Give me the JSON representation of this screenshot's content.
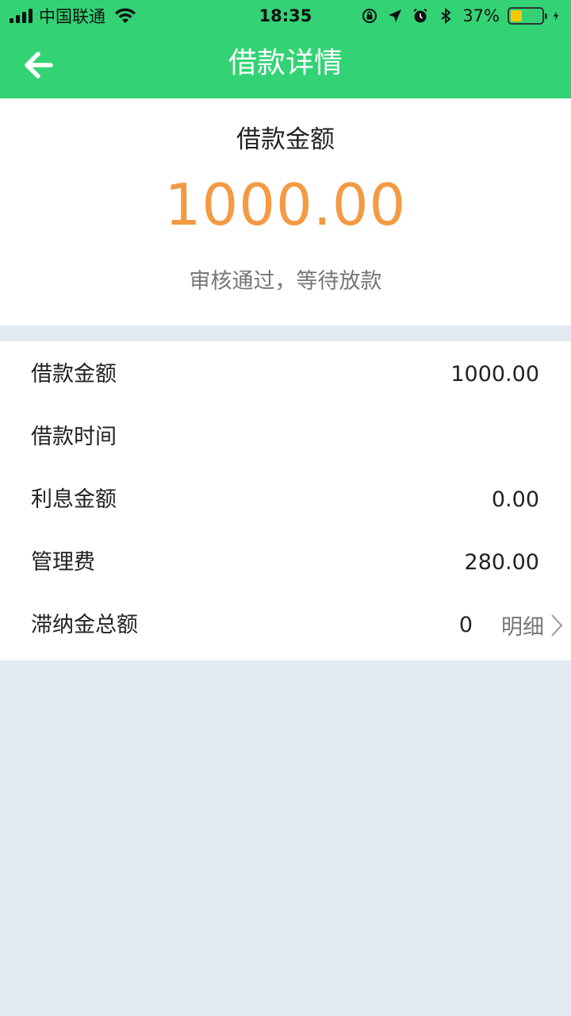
{
  "status_bar": {
    "carrier": "中国联通",
    "time": "18:35",
    "battery_percent": "37%",
    "battery_level": 0.37,
    "battery_color": "#f7c800"
  },
  "nav": {
    "title": "借款详情",
    "back_icon": "arrow-left-icon",
    "bg_color": "#33d375"
  },
  "summary": {
    "label": "借款金额",
    "amount": "1000.00",
    "status": "审核通过，等待放款",
    "amount_color": "#f39a43"
  },
  "details": {
    "rows": [
      {
        "label": "借款金额",
        "value": "1000.00"
      },
      {
        "label": "借款时间",
        "value": ""
      },
      {
        "label": "利息金额",
        "value": "0.00"
      },
      {
        "label": "管理费",
        "value": "280.00"
      },
      {
        "label": "滞纳金总额",
        "value": "0",
        "link": "明细"
      }
    ]
  }
}
